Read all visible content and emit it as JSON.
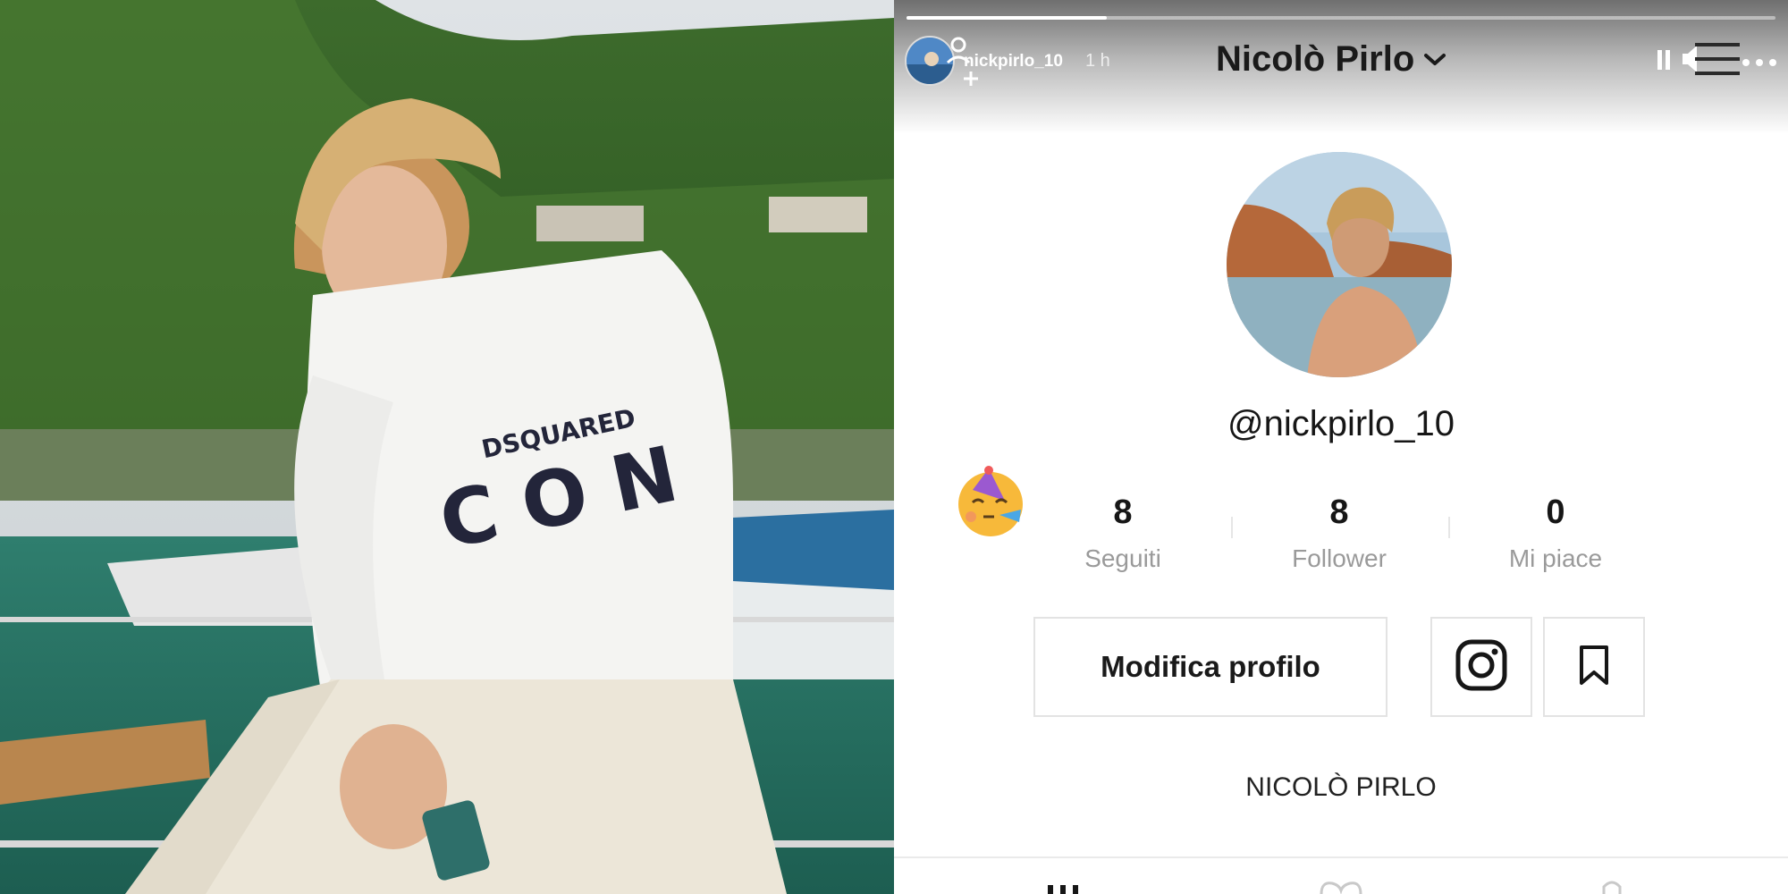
{
  "story": {
    "progress": 0.23,
    "username": "nickpirlo_10",
    "time": "1 h"
  },
  "profile": {
    "display_name": "Nicolò Pirlo",
    "handle": "@nickpirlo_10",
    "stats": [
      {
        "value": "8",
        "label": "Seguiti"
      },
      {
        "value": "8",
        "label": "Follower"
      },
      {
        "value": "0",
        "label": "Mi piace"
      }
    ],
    "edit_button": "Modifica profilo",
    "bio": "NICOLÒ PIRLO"
  },
  "icons": [
    "add-user-icon",
    "chevron-down-icon",
    "pause-icon",
    "mute-icon",
    "menu-icon",
    "more-icon",
    "party-face-emoji",
    "instagram-icon",
    "bookmark-icon",
    "grid-icon",
    "heart-icon",
    "lock-icon"
  ],
  "colors": {
    "text": "#161616",
    "muted": "#9a9a9a",
    "border": "#e3e3e3"
  }
}
